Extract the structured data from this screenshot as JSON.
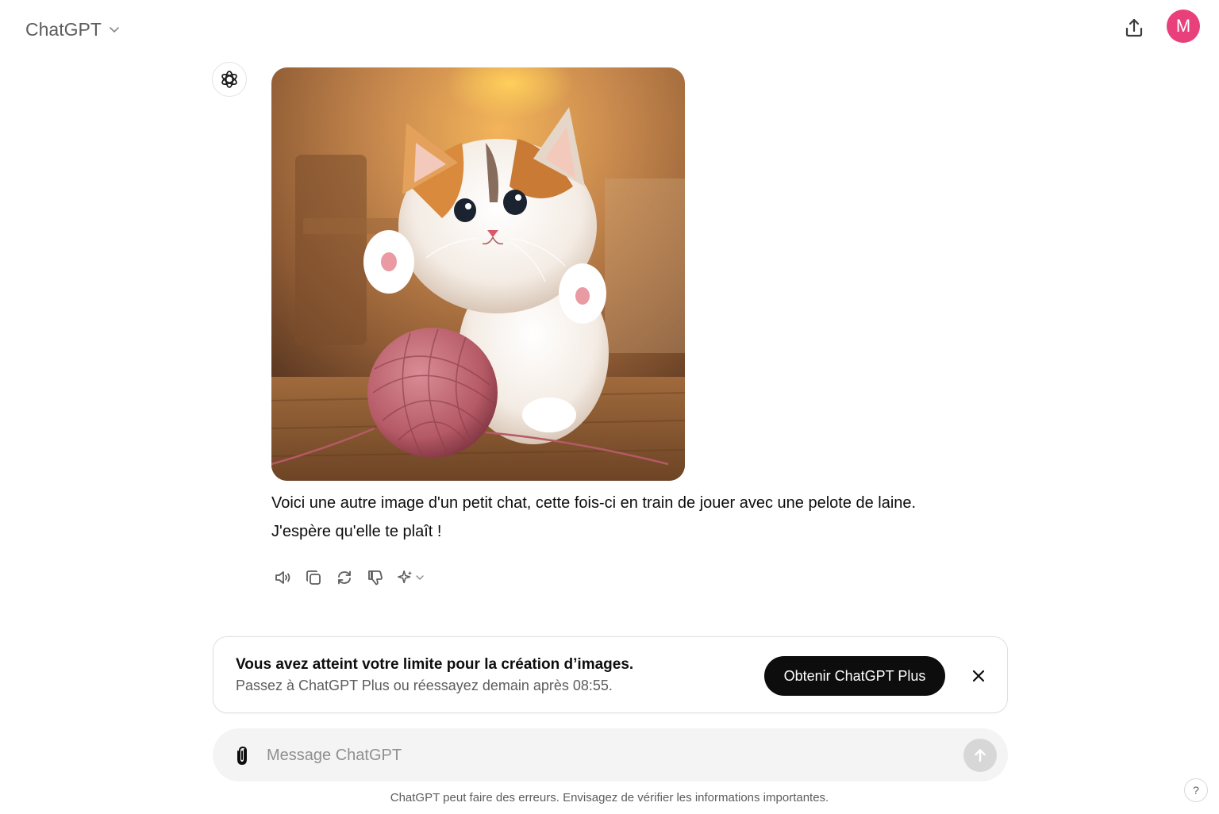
{
  "header": {
    "model_name": "ChatGPT",
    "avatar_initial": "M"
  },
  "assistant": {
    "avatar_icon": "openai-logo-icon",
    "image_icon": "kitten-with-yarn-ball-image",
    "message_lines": [
      "Voici une autre image d'un petit chat, cette fois-ci en train de jouer avec une pelote de laine.",
      "J'espère qu'elle te plaît !"
    ],
    "actions": [
      {
        "name": "read-aloud",
        "icon": "speaker-icon"
      },
      {
        "name": "copy",
        "icon": "copy-icon"
      },
      {
        "name": "regenerate",
        "icon": "refresh-icon"
      },
      {
        "name": "bad-response",
        "icon": "thumbs-down-icon"
      },
      {
        "name": "switch-model",
        "icon": "sparkle-icon"
      }
    ]
  },
  "limit_banner": {
    "title": "Vous avez atteint votre limite pour la création d’images.",
    "subtitle": "Passez à ChatGPT Plus ou réessayez demain après 08:55.",
    "upgrade_label": "Obtenir ChatGPT Plus",
    "close_icon": "close-icon"
  },
  "composer": {
    "placeholder": "Message ChatGPT",
    "value": "",
    "attach_icon": "paperclip-icon",
    "send_icon": "arrow-up-icon"
  },
  "footer": {
    "disclaimer": "ChatGPT peut faire des erreurs. Envisagez de vérifier les informations importantes.",
    "help_label": "?"
  },
  "colors": {
    "avatar": "#e8407a",
    "upgrade_button": "#0d0d0d",
    "composer_bg": "#f4f4f4",
    "send_button_disabled": "#d7d7d7"
  }
}
